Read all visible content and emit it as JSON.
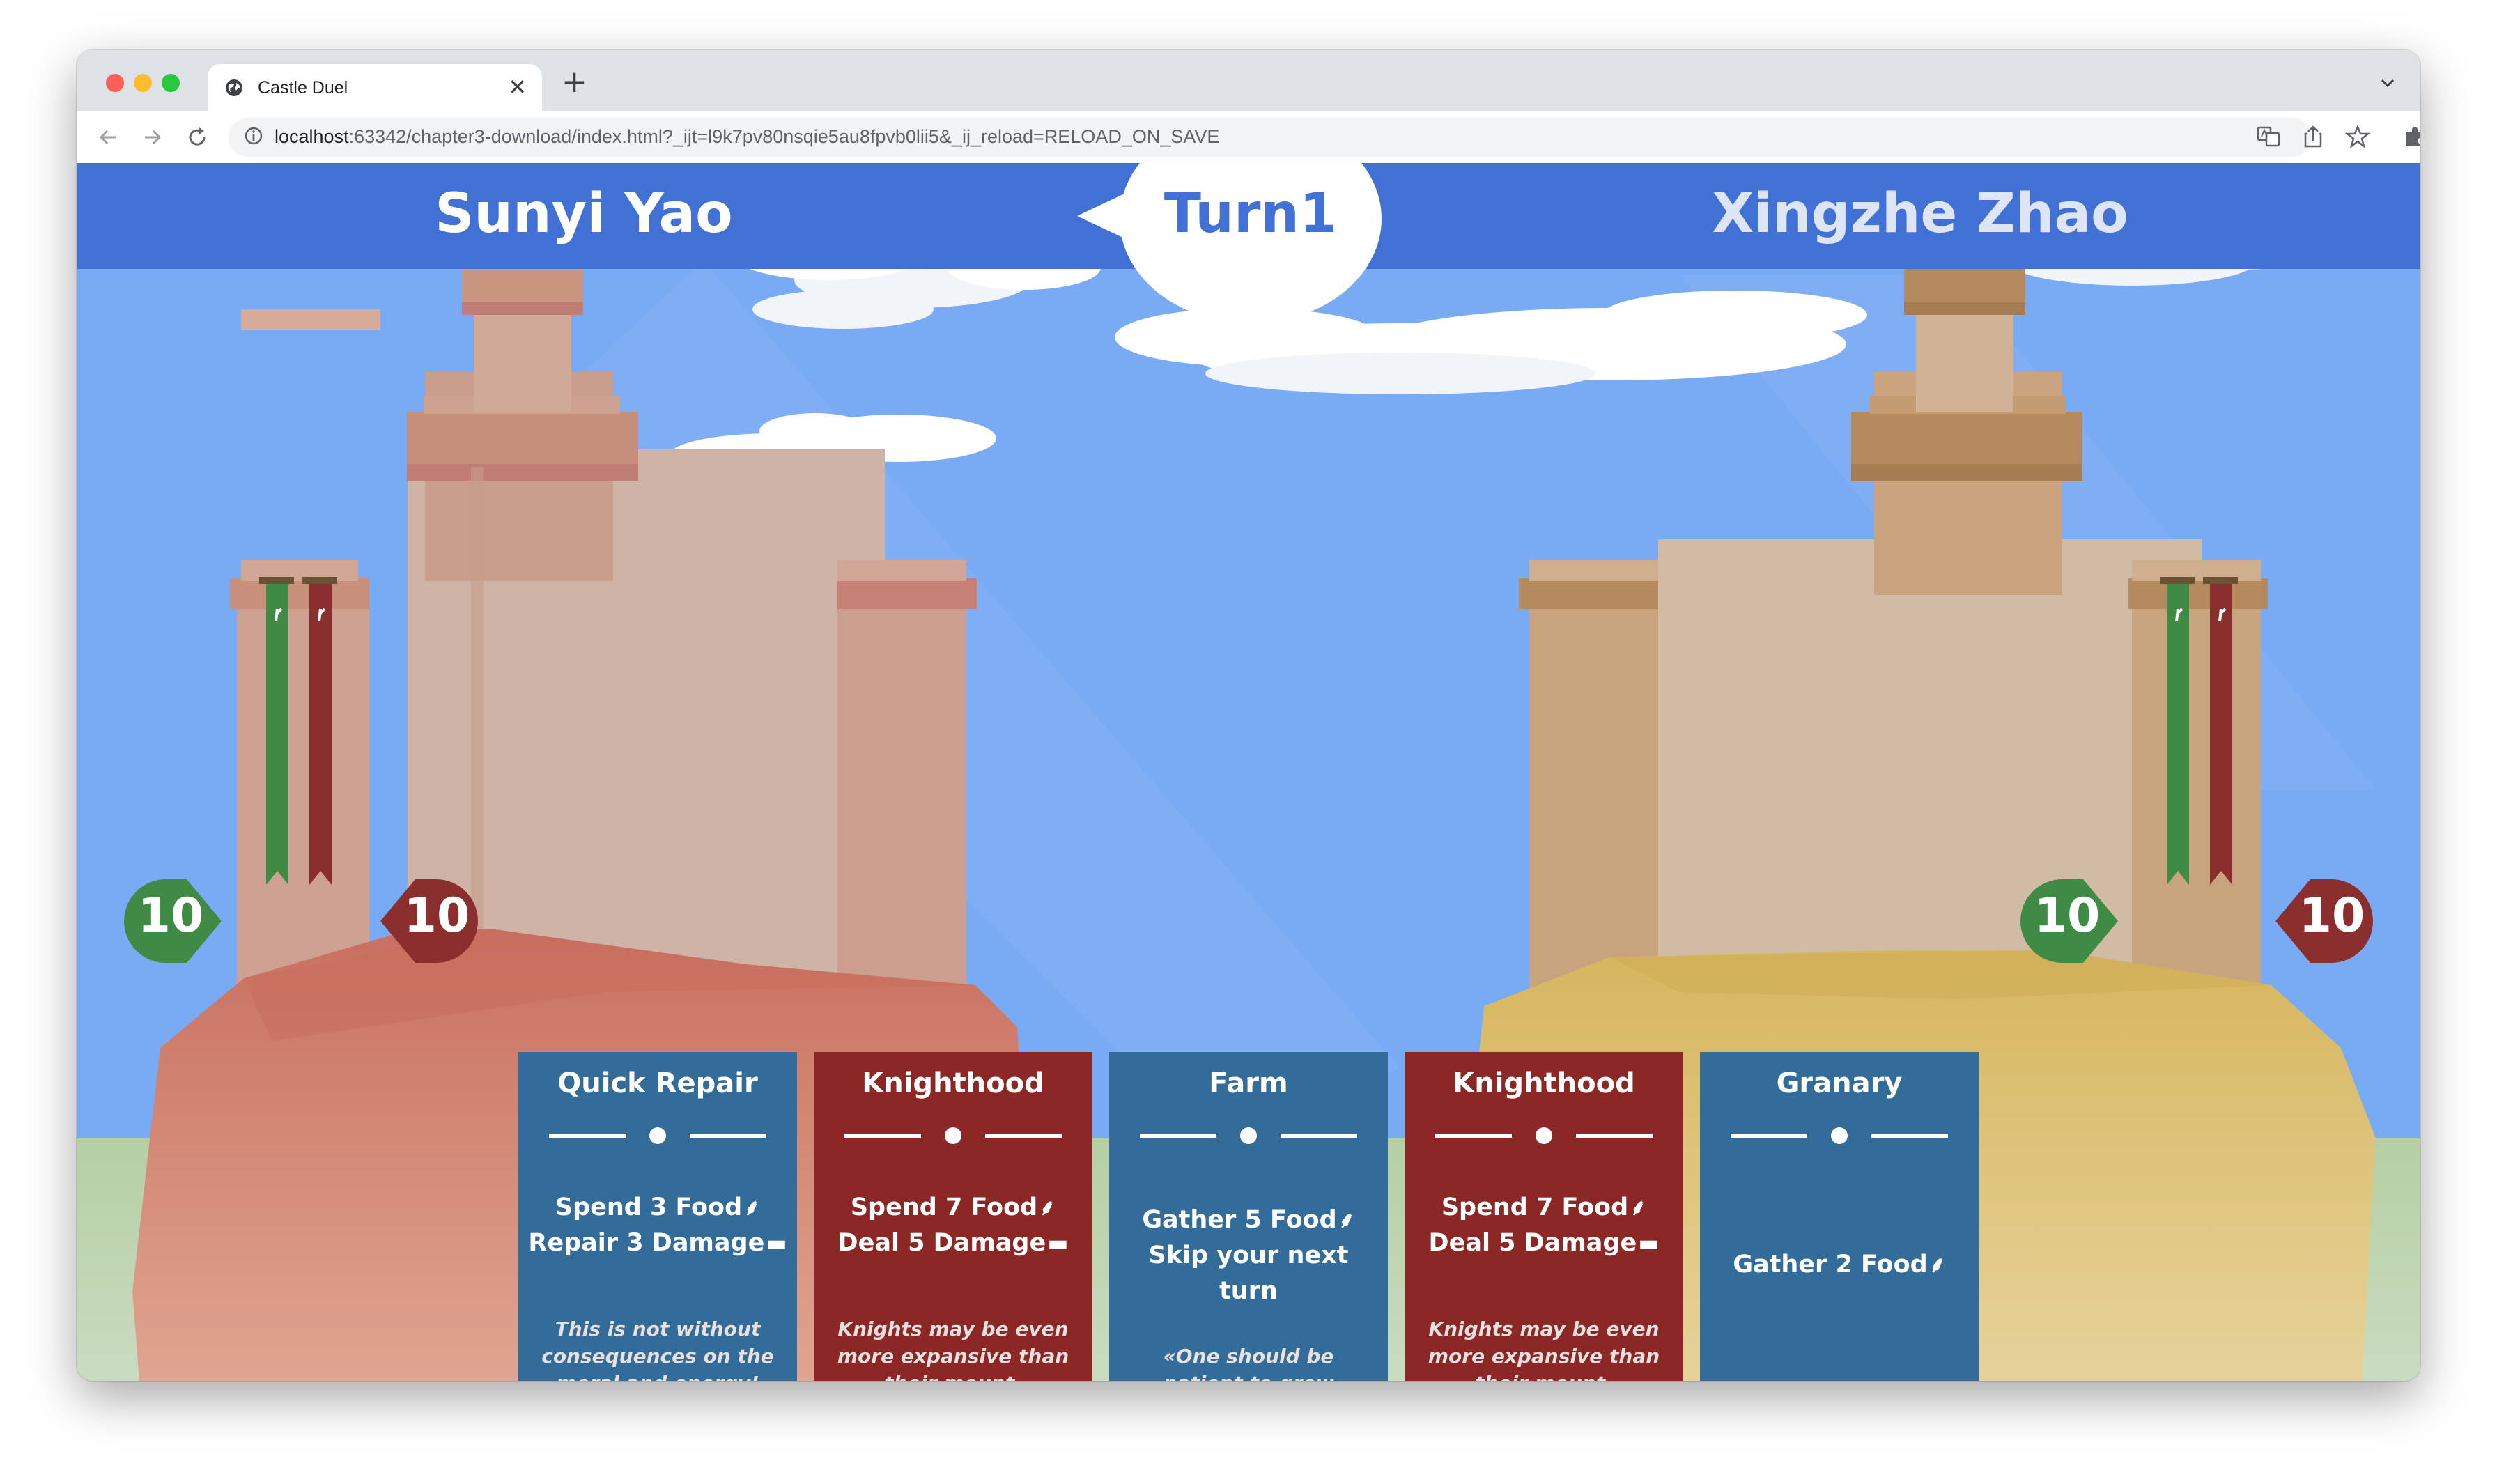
{
  "browser": {
    "tab_title": "Castle Duel",
    "tab_favicon": "globe-icon",
    "close_tab_label": "✕",
    "new_tab_label": "+",
    "url_host": "localhost",
    "url_rest": ":63342/chapter3-download/index.html?_ijt=l9k7pv80nsqie5au8fpvb0lii5&_ij_reload=RELOAD_ON_SAVE"
  },
  "game": {
    "players": [
      {
        "name": "Sunyi Yao",
        "food": "10",
        "health": "10"
      },
      {
        "name": "Xingzhe Zhao",
        "food": "10",
        "health": "10"
      }
    ],
    "turn_label": "Turn1",
    "colors": {
      "bar": "#4271d6",
      "sky": "#79aaf4",
      "food_badge": "#3f8a45",
      "health_badge": "#8b2f2e",
      "card_blue": "#336b99",
      "card_red": "#8b2724"
    },
    "cards": [
      {
        "title": "Quick Repair",
        "color": "blue",
        "lines": [
          "Spend 3 Food",
          "Repair 3 Damage"
        ],
        "icons": [
          "wheat-icon",
          "bricks-icon"
        ],
        "flavor": "This is not without consequences on the moral and energy!"
      },
      {
        "title": "Knighthood",
        "color": "red",
        "lines": [
          "Spend 7 Food",
          "Deal 5 Damage"
        ],
        "icons": [
          "wheat-icon",
          "bricks-icon"
        ],
        "flavor": "Knights may be even more expansive than their mount."
      },
      {
        "title": "Farm",
        "color": "blue",
        "lines": [
          "Gather 5 Food",
          "Skip your next turn"
        ],
        "icons": [
          "wheat-icon",
          ""
        ],
        "flavor": "«One should be patient to grow crops.»"
      },
      {
        "title": "Knighthood",
        "color": "red",
        "lines": [
          "Spend 7 Food",
          "Deal 5 Damage"
        ],
        "icons": [
          "wheat-icon",
          "bricks-icon"
        ],
        "flavor": "Knights may be even more expansive than their mount."
      },
      {
        "title": "Granary",
        "color": "blue",
        "lines": [
          "Gather 2 Food"
        ],
        "icons": [
          "wheat-icon"
        ],
        "flavor": ""
      }
    ]
  }
}
